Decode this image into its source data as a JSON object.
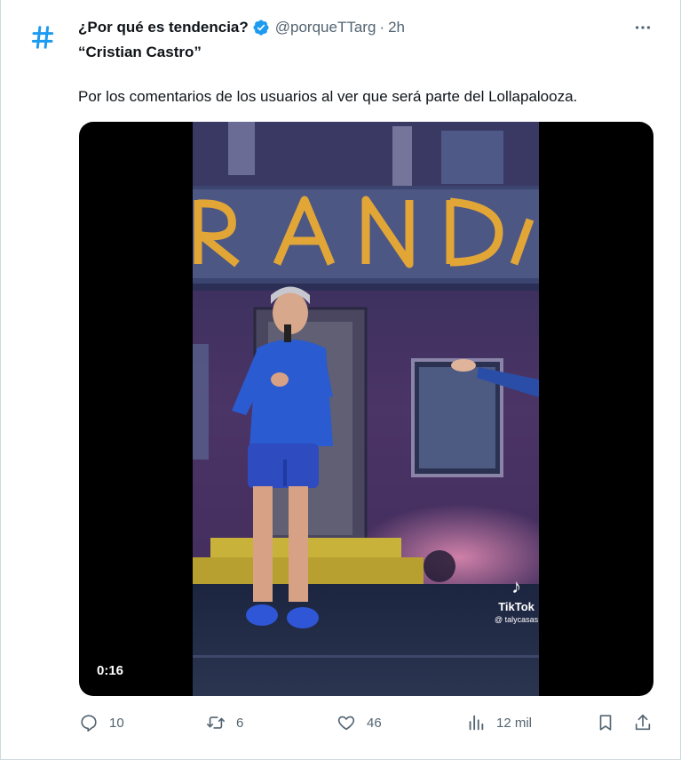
{
  "tweet": {
    "author_name": "¿Por qué es tendencia?",
    "handle": "@porqueTTarg",
    "separator": "·",
    "time": "2h",
    "avatar_icon": "hashtag-icon",
    "quote_title": "“Cristian Castro”",
    "body": "Por los comentarios de los usuarios al ver que será parte del Lollapalooza.",
    "verified": true
  },
  "media": {
    "duration": "0:16",
    "watermark_label": "TikTok",
    "watermark_user": "@ talycasas",
    "sign_text": "RANDA"
  },
  "actions": {
    "replies": "10",
    "retweets": "6",
    "likes": "46",
    "views": "12 mil"
  },
  "colors": {
    "accent": "#1d9bf0",
    "muted": "#536471",
    "text": "#0f1419"
  }
}
